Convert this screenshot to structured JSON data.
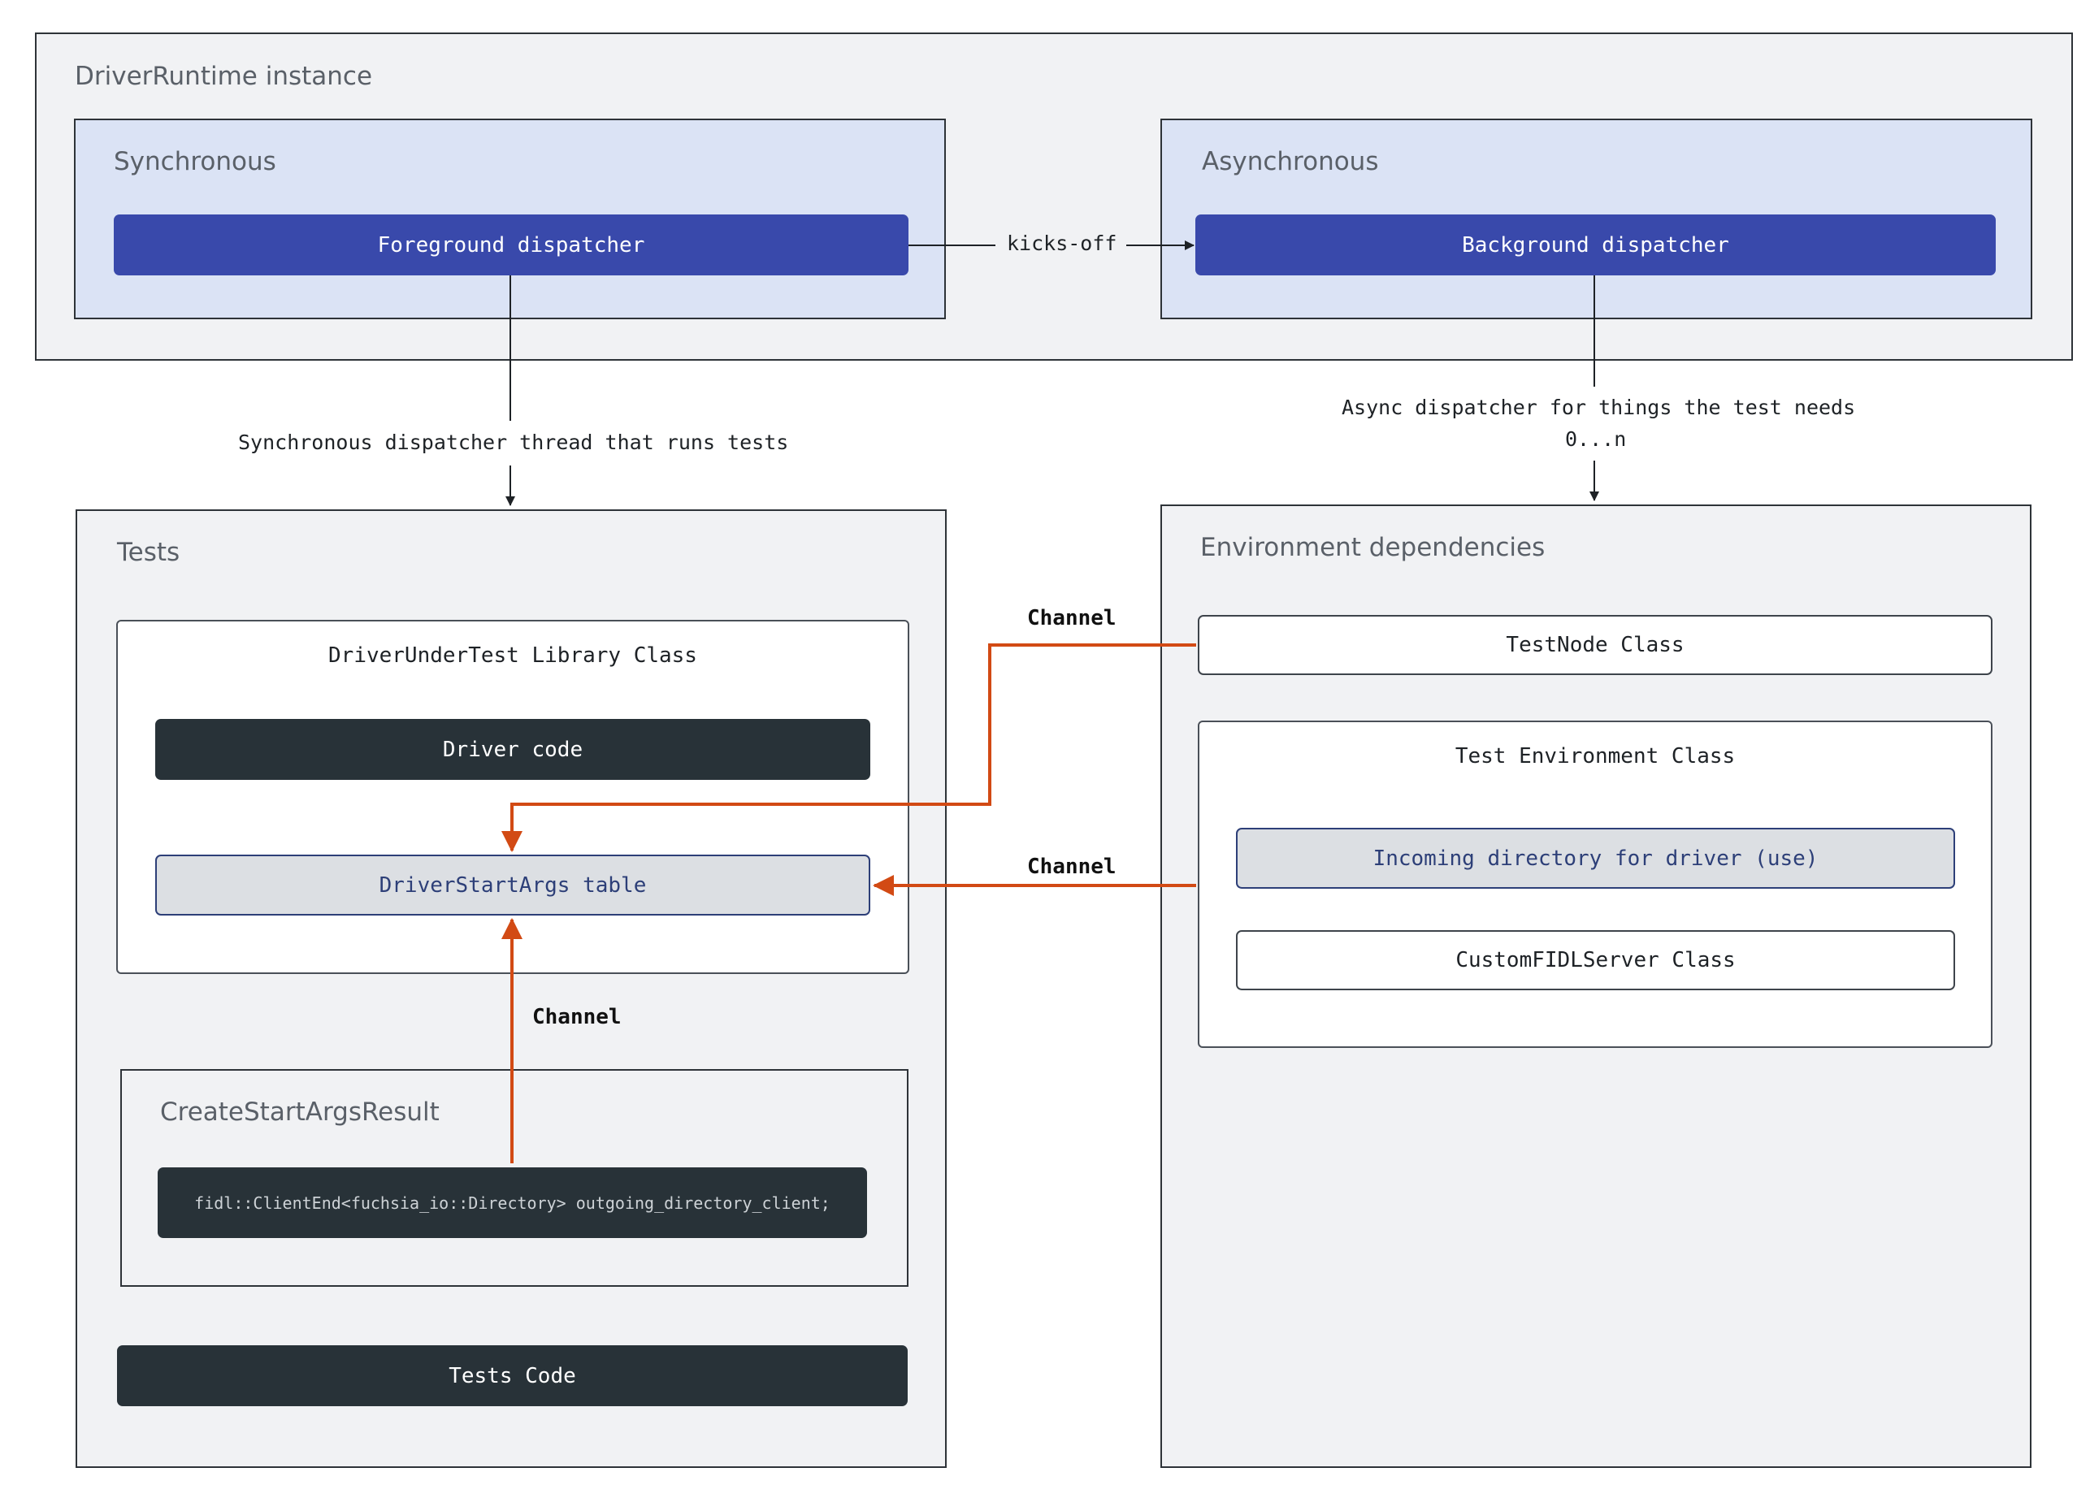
{
  "runtime": {
    "title": "DriverRuntime instance",
    "sync": {
      "title": "Synchronous",
      "dispatcher": "Foreground dispatcher"
    },
    "async": {
      "title": "Asynchronous",
      "dispatcher": "Background dispatcher"
    },
    "kickoff_label": "kicks-off"
  },
  "connectors": {
    "sync_thread": "Synchronous dispatcher thread that runs tests",
    "async_line1": "Async dispatcher for things the test needs",
    "async_line2": "0...n"
  },
  "tests": {
    "title": "Tests",
    "driver_under_test": {
      "title": "DriverUnderTest Library Class",
      "driver_code": "Driver code",
      "start_args": "DriverStartArgs table"
    },
    "create_result": {
      "title": "CreateStartArgsResult",
      "code": "fidl::ClientEnd<fuchsia_io::Directory> outgoing_directory_client;"
    },
    "tests_code": "Tests Code"
  },
  "env": {
    "title": "Environment dependencies",
    "test_node": "TestNode Class",
    "test_env": {
      "title": "Test Environment Class",
      "incoming": "Incoming directory for driver (use)",
      "custom_server": "CustomFIDLServer Class"
    }
  },
  "channels": {
    "top": "Channel",
    "middle": "Channel",
    "bottom": "Channel"
  },
  "colors": {
    "channel_arrow": "#d24a14",
    "dispatcher": "#3949ab",
    "dark_bar": "#283238",
    "panel_bg": "#f1f2f4",
    "subpanel_bg": "#dbe3f5"
  }
}
